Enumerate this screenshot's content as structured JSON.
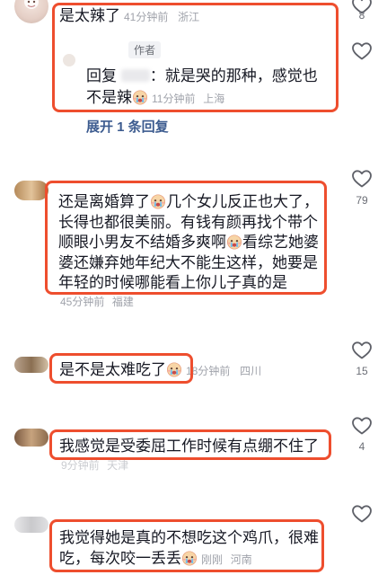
{
  "comments": [
    {
      "text": "是太辣了",
      "time": "41分钟前",
      "location": "浙江",
      "likes": "8",
      "reply": {
        "author_tag": "作者",
        "prefix": "回复",
        "text_line1": "：就是哭的那种，感觉也",
        "text_line2": "不是辣",
        "time": "11分钟前",
        "location": "上海",
        "likes": "",
        "expand_label": "展开 1 条回复"
      }
    },
    {
      "line1a": "还是离婚算了",
      "line1b": "几个女儿反正也大了，",
      "line2": "长得也都很美丽。有钱有颜再找个带个",
      "line3a": "顺眼小男友不结婚多爽啊",
      "line3b": "看综艺她婆",
      "line4": "婆还嫌弃她年纪大不能生这样，她要是",
      "line5": "年轻的时候哪能看上你儿子真的是",
      "time": "45分钟前",
      "location": "福建",
      "likes": "79"
    },
    {
      "text": "是不是太难吃了",
      "time": "18分钟前",
      "location": "四川",
      "likes": "15"
    },
    {
      "text": "我感觉是受委屈工作时候有点绷不住了",
      "time": "9分钟前",
      "location": "天津",
      "likes": "4"
    },
    {
      "line1": "我觉得她是真的不想吃这个鸡爪，很难",
      "line2": "吃，每次咬一丢丢",
      "time": "刚刚",
      "location": "河南",
      "likes": ""
    }
  ],
  "icons": {
    "like": "heart-outline-icon",
    "emoji": "crying-face-emoji-icon"
  },
  "colors": {
    "highlight": "#ee4e2e",
    "text": "#161823",
    "meta": "#a0a3ab",
    "expand": "#3c5b8f"
  }
}
